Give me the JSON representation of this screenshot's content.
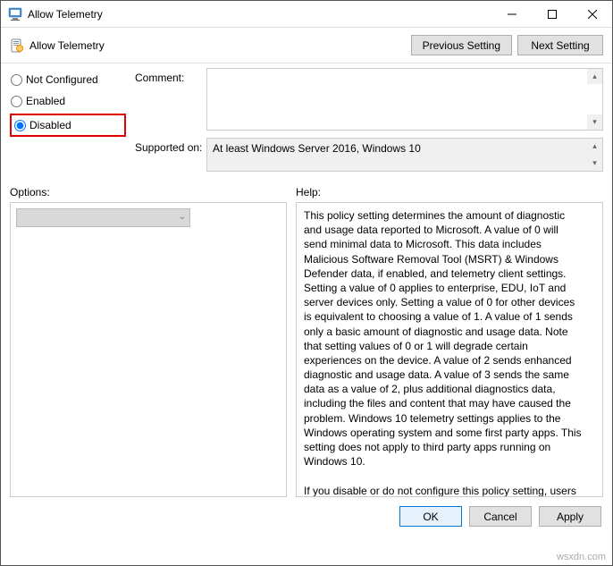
{
  "window": {
    "title": "Allow Telemetry"
  },
  "toolbar": {
    "policy_title": "Allow Telemetry",
    "prev_label": "Previous Setting",
    "next_label": "Next Setting"
  },
  "radios": {
    "not_configured": "Not Configured",
    "enabled": "Enabled",
    "disabled": "Disabled",
    "selected": "disabled"
  },
  "fields": {
    "comment_label": "Comment:",
    "comment_value": "",
    "supported_label": "Supported on:",
    "supported_value": "At least Windows Server 2016, Windows 10"
  },
  "sections": {
    "options_label": "Options:",
    "help_label": "Help:"
  },
  "help": {
    "para1": "This policy setting determines the amount of diagnostic and usage data reported to Microsoft. A value of 0 will send minimal data to Microsoft. This data includes Malicious Software Removal Tool (MSRT) & Windows Defender data, if enabled, and telemetry client settings. Setting a value of 0 applies to enterprise, EDU, IoT and server devices only. Setting a value of 0 for other devices is equivalent to choosing a value of 1. A value of 1 sends only a basic amount of diagnostic and usage data. Note that setting values of 0 or 1 will degrade certain experiences on the device. A value of 2 sends enhanced diagnostic and usage data. A value of 3 sends the same data as a value of 2, plus additional diagnostics data, including the files and content that may have caused the problem. Windows 10 telemetry settings applies to the Windows operating system and some first party apps. This setting does not apply to third party apps running on Windows 10.",
    "para2": "If you disable or do not configure this policy setting, users can configure the Telemetry level in Settings."
  },
  "buttons": {
    "ok": "OK",
    "cancel": "Cancel",
    "apply": "Apply"
  },
  "watermark": "wsxdn.com"
}
